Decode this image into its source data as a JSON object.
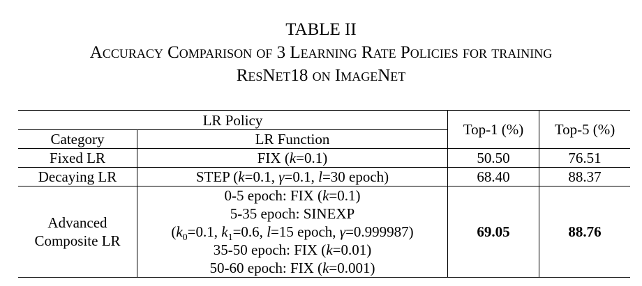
{
  "table_label": "TABLE II",
  "caption_line1": "Accuracy Comparison of 3 Learning Rate Policies for training",
  "caption_line2": "ResNet18 on ImageNet",
  "header": {
    "lr_policy": "LR Policy",
    "category": "Category",
    "lr_function": "LR Function",
    "top1": "Top-1 (%)",
    "top5": "Top-5 (%)"
  },
  "rows": [
    {
      "category": "Fixed LR",
      "function": "FIX (k=0.1)",
      "top1": "50.50",
      "top5": "76.51"
    },
    {
      "category": "Decaying LR",
      "function": "STEP (k=0.1, γ=0.1, l=30 epoch)",
      "top1": "68.40",
      "top5": "88.37"
    }
  ],
  "advanced": {
    "category_line1": "Advanced",
    "category_line2": "Composite LR",
    "function_lines": [
      "0-5 epoch: FIX (k=0.1)",
      "5-35 epoch: SINEXP",
      "(k0=0.1, k1=0.6, l=15 epoch, γ=0.999987)",
      "35-50 epoch: FIX (k=0.01)",
      "50-60 epoch: FIX (k=0.001)"
    ],
    "top1": "69.05",
    "top5": "88.76"
  }
}
